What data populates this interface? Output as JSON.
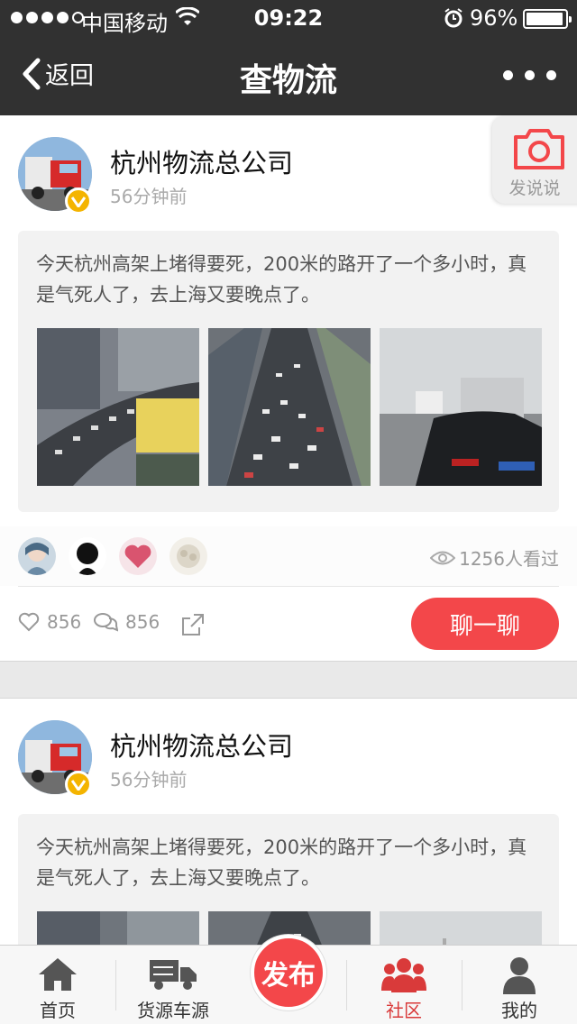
{
  "status": {
    "carrier": "中国移动",
    "time": "09:22",
    "battery": "96%",
    "battery_level": 0.96
  },
  "nav": {
    "back_label": "返回",
    "title": "查物流"
  },
  "camera_fab": {
    "label": "发说说"
  },
  "posts": [
    {
      "author": "杭州物流总公司",
      "time_ago": "56分钟前",
      "text": "今天杭州高架上堵得要死，200米的路开了一个多小时，真是气死人了，去上海又要晚点了。",
      "views": "1256人看过",
      "likes": "856",
      "comments": "856",
      "chat_label": "聊一聊"
    },
    {
      "author": "杭州物流总公司",
      "time_ago": "56分钟前",
      "text": "今天杭州高架上堵得要死，200米的路开了一个多小时，真是气死人了，去上海又要晚点了。"
    }
  ],
  "tabs": [
    {
      "label": "首页",
      "icon": "home-icon"
    },
    {
      "label": "货源车源",
      "icon": "truck-icon"
    },
    {
      "label": "发布",
      "icon": "publish-button"
    },
    {
      "label": "社区",
      "icon": "community-icon"
    },
    {
      "label": "我的",
      "icon": "profile-icon"
    }
  ],
  "colors": {
    "topbar": "#313131",
    "accent_red": "#f3474a",
    "active_tab": "#d93a3a",
    "verified": "#f4b400"
  }
}
